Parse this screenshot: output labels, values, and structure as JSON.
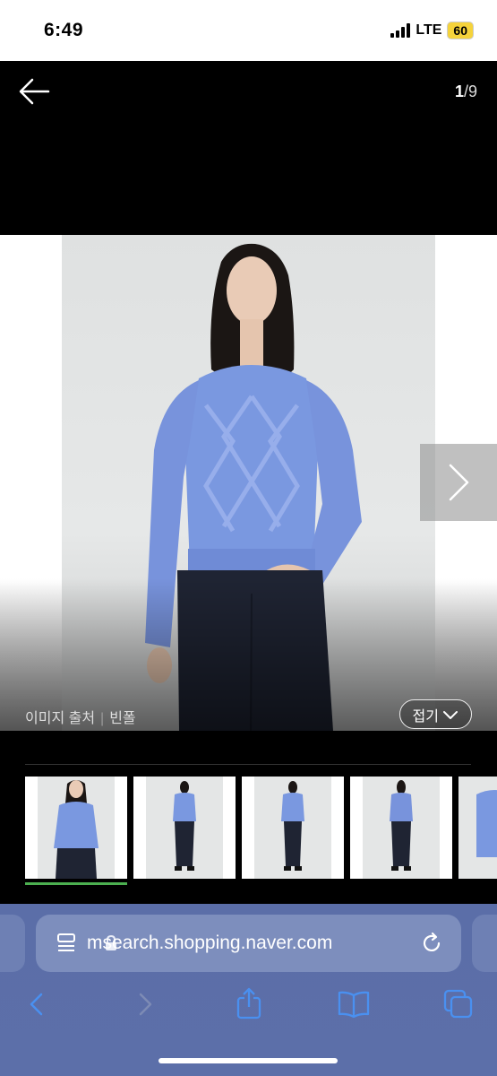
{
  "status_bar": {
    "time": "6:49",
    "network": "LTE",
    "battery": "60"
  },
  "viewer": {
    "page_current": "1",
    "page_total": "/9",
    "image_source_label": "이미지 출처",
    "image_source_name": "빈폴",
    "collapse_label": "접기",
    "thumbnail_count": 5,
    "selected_thumbnail": 1
  },
  "browser": {
    "url": "msearch.shopping.naver.com"
  },
  "icons": {
    "back": "arrow-left-icon",
    "next": "chevron-right-icon",
    "collapse": "chevron-down-icon",
    "reader": "reader-mode-icon",
    "lock": "lock-icon",
    "reload": "reload-icon",
    "nav_back": "chevron-left-icon",
    "nav_forward": "chevron-right-icon",
    "share": "share-icon",
    "bookmarks": "book-icon",
    "tabs": "tabs-icon"
  },
  "colors": {
    "sweater": "#7a98e0",
    "pants": "#1f2433",
    "accent_green": "#4caf50",
    "browser_bar": "#5b6ea8"
  }
}
